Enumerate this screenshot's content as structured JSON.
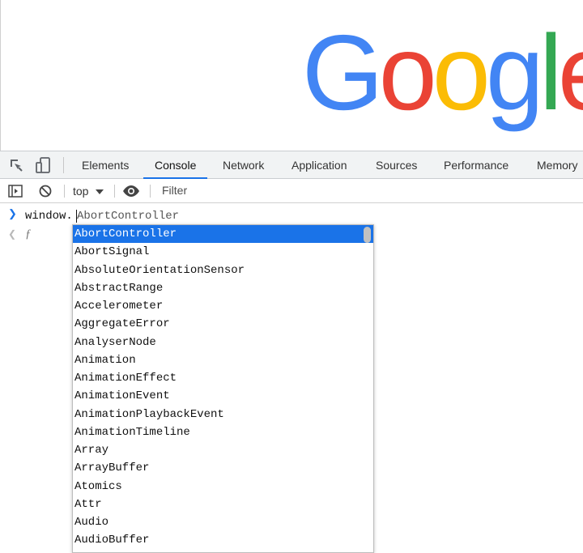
{
  "brand": {
    "logo_letters": [
      "G",
      "o",
      "o",
      "g",
      "l",
      "e"
    ],
    "colors": [
      "#4285f4",
      "#ea4335",
      "#fbbc05",
      "#4285f4",
      "#34a853",
      "#ea4335"
    ]
  },
  "devtools": {
    "tool_icons": [
      "inspect-element-icon",
      "device-toolbar-icon"
    ],
    "tabs": [
      {
        "label": "Elements"
      },
      {
        "label": "Console",
        "active": true
      },
      {
        "label": "Network"
      },
      {
        "label": "Application"
      },
      {
        "label": "Sources"
      },
      {
        "label": "Performance"
      },
      {
        "label": "Memory"
      }
    ]
  },
  "console_toolbar": {
    "icons": [
      "sidebar-toggle-icon",
      "clear-console-icon",
      "eye-icon"
    ],
    "context": "top",
    "context_icon": "dropdown-triangle-icon",
    "filter_placeholder": "Filter"
  },
  "console": {
    "input_text": "window.",
    "autocomplete_ghost": "AbortController",
    "result_icon": "result-arrow-icon",
    "result_value": "ƒ",
    "suggestions": [
      "AbortController",
      "AbortSignal",
      "AbsoluteOrientationSensor",
      "AbstractRange",
      "Accelerometer",
      "AggregateError",
      "AnalyserNode",
      "Animation",
      "AnimationEffect",
      "AnimationEvent",
      "AnimationPlaybackEvent",
      "AnimationTimeline",
      "Array",
      "ArrayBuffer",
      "Atomics",
      "Attr",
      "Audio",
      "AudioBuffer"
    ],
    "selected_index": 0
  }
}
